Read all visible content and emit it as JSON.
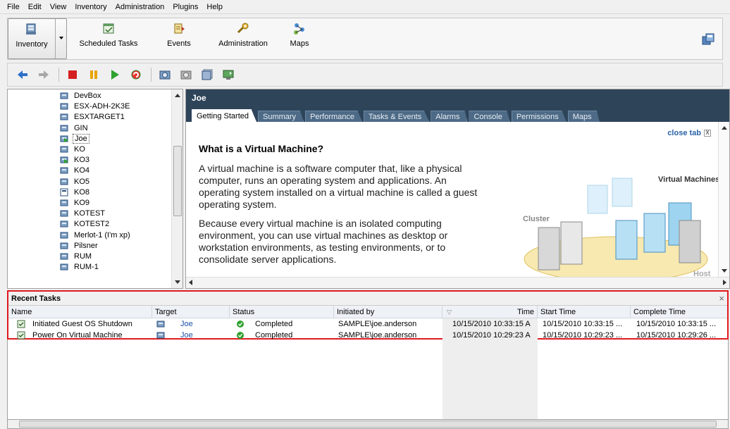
{
  "menu": [
    "File",
    "Edit",
    "View",
    "Inventory",
    "Administration",
    "Plugins",
    "Help"
  ],
  "toolbar": {
    "inventory": "Inventory",
    "scheduled_tasks": "Scheduled Tasks",
    "events": "Events",
    "administration": "Administration",
    "maps": "Maps"
  },
  "tree": {
    "items": [
      "DevBox",
      "ESX-ADH-2K3E",
      "ESXTARGET1",
      "GIN",
      "Joe",
      "KO",
      "KO3",
      "KO4",
      "KO5",
      "KO8",
      "KO9",
      "KOTEST",
      "KOTEST2",
      "Merlot-1 (I'm xp)",
      "Pilsner",
      "RUM",
      "RUM-1"
    ],
    "selected": "Joe"
  },
  "detail": {
    "title": "Joe",
    "tabs": [
      "Getting Started",
      "Summary",
      "Performance",
      "Tasks & Events",
      "Alarms",
      "Console",
      "Permissions",
      "Maps"
    ],
    "active_tab": "Getting Started",
    "close_tab": "close tab",
    "heading": "What is a Virtual Machine?",
    "para1": "A virtual machine is a software computer that, like a physical computer, runs an operating system and applications. An operating system installed on a virtual machine is called a guest operating system.",
    "para2": "Because every virtual machine is an isolated computing environment, you can use virtual machines as desktop or workstation environments, as testing environments, or to consolidate server applications.",
    "illus_labels": {
      "vms": "Virtual Machines",
      "cluster": "Cluster",
      "host": "Host"
    }
  },
  "recent_tasks": {
    "title": "Recent Tasks",
    "columns": [
      "Name",
      "Target",
      "Status",
      "Initiated by",
      "Time",
      "Start Time",
      "Complete Time"
    ],
    "rows": [
      {
        "name": "Initiated Guest OS Shutdown",
        "target": "Joe",
        "status": "Completed",
        "initiated_by": "SAMPLE\\joe.anderson",
        "time": "10/15/2010 10:33:15 A",
        "start": "10/15/2010 10:33:15 ...",
        "complete": "10/15/2010 10:33:15 ..."
      },
      {
        "name": "Power On Virtual Machine",
        "target": "Joe",
        "status": "Completed",
        "initiated_by": "SAMPLE\\joe.anderson",
        "time": "10/15/2010 10:29:23 A",
        "start": "10/15/2010 10:29:23 ...",
        "complete": "10/15/2010 10:29:26 ..."
      }
    ]
  },
  "colors": {
    "header_bg": "#2e4459",
    "highlight": "#e0191f",
    "link": "#1a4fa3"
  }
}
